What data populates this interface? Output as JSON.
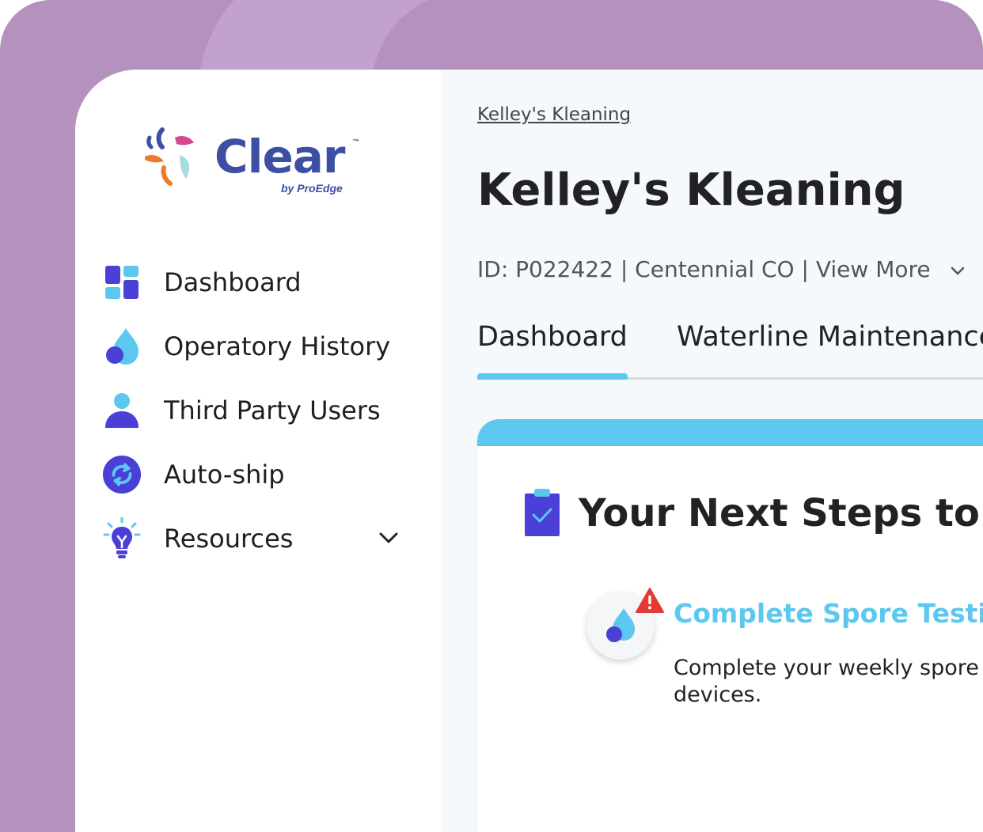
{
  "brand": {
    "name": "Clear",
    "trademark": "™",
    "subtitle": "by ProEdge"
  },
  "sidebar": {
    "items": [
      {
        "label": "Dashboard",
        "icon": "dashboard-grid-icon"
      },
      {
        "label": "Operatory History",
        "icon": "water-drop-icon"
      },
      {
        "label": "Third Party Users",
        "icon": "user-icon"
      },
      {
        "label": "Auto-ship",
        "icon": "refresh-cycle-icon"
      },
      {
        "label": "Resources",
        "icon": "lightbulb-icon",
        "expandable": true
      }
    ]
  },
  "main": {
    "breadcrumb": "Kelley's Kleaning",
    "title": "Kelley's Kleaning",
    "meta": {
      "id": "ID: P022422",
      "sep": " | ",
      "location": "Centennial CO",
      "view_more": "View More"
    },
    "tabs": [
      {
        "label": "Dashboard",
        "active": true
      },
      {
        "label": "Waterline Maintenance",
        "active": false
      }
    ],
    "card": {
      "title": "Your Next Steps to Co",
      "step": {
        "title": "Complete Spore Testing",
        "description": "Complete your weekly spore devices."
      }
    }
  },
  "colors": {
    "accent": "#5cc8ef",
    "brand_blue": "#3d4fa3",
    "icon_purple": "#4a3fd6",
    "frame_purple": "#b592bd",
    "warning_red": "#e53935"
  }
}
